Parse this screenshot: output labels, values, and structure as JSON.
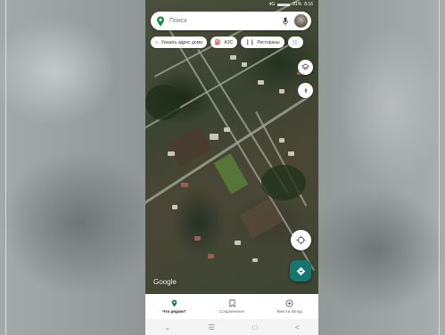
{
  "app": {
    "name": "Google Maps"
  },
  "status_bar": {
    "time": "8:16",
    "battery": "81%",
    "network": "4G"
  },
  "search": {
    "placeholder": "Поиск"
  },
  "chips": [
    {
      "icon": "home-icon",
      "label": "Указать адрес дома"
    },
    {
      "icon": "gas-station-icon",
      "label": "АЗС"
    },
    {
      "icon": "restaurant-icon",
      "label": "Рестораны"
    },
    {
      "icon": "shopping-cart-icon",
      "label": ""
    }
  ],
  "map": {
    "attribution": "Google",
    "layer": "satellite"
  },
  "bottom_nav": {
    "items": [
      {
        "icon": "explore-pin-icon",
        "label": "Что рядом?",
        "active": true
      },
      {
        "icon": "bookmark-icon",
        "label": "Сохраненное",
        "active": false
      },
      {
        "icon": "contribute-icon",
        "label": "Внести вклад",
        "active": false
      }
    ]
  },
  "system_nav": {
    "items": [
      "chevron-down-icon",
      "menu-icon",
      "home-icon",
      "back-icon"
    ]
  },
  "colors": {
    "directions_fab": "#17756d",
    "accent_pin": "#1a8d47"
  }
}
